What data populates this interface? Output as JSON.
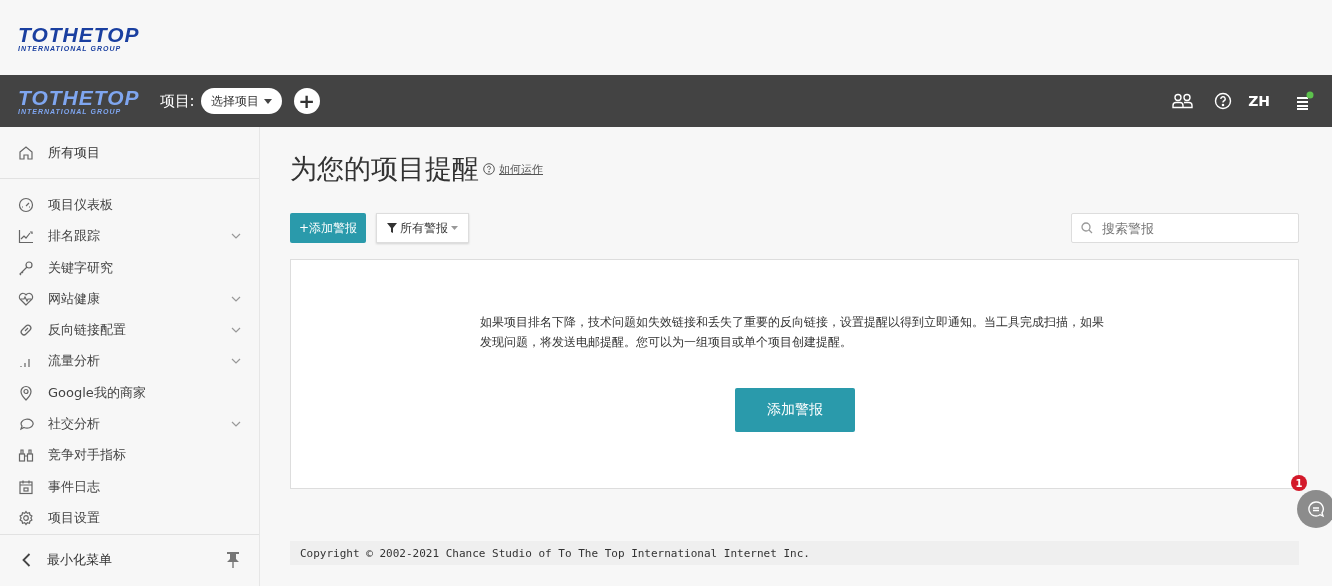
{
  "logo": {
    "name": "TOTHETOP",
    "tagline": "INTERNATIONAL GROUP"
  },
  "navbar": {
    "logo": {
      "name": "TOTHETOP",
      "tagline": "INTERNATIONAL GROUP"
    },
    "project_label": "项目:",
    "project_select": "选择项目",
    "add": "+",
    "language": "ZH",
    "menu_notification": true
  },
  "sidebar": {
    "top_item": {
      "label": "所有项目"
    },
    "items": [
      {
        "label": "项目仪表板",
        "expandable": false
      },
      {
        "label": "排名跟踪",
        "expandable": true
      },
      {
        "label": "关键字研究",
        "expandable": false
      },
      {
        "label": "网站健康",
        "expandable": true
      },
      {
        "label": "反向链接配置",
        "expandable": true
      },
      {
        "label": "流量分析",
        "expandable": true
      },
      {
        "label": "Google我的商家",
        "expandable": false
      },
      {
        "label": "社交分析",
        "expandable": true
      },
      {
        "label": "竞争对手指标",
        "expandable": false
      },
      {
        "label": "事件日志",
        "expandable": false
      },
      {
        "label": "项目设置",
        "expandable": false
      }
    ],
    "minimize": "最小化菜单"
  },
  "main": {
    "title": "为您的项目提醒",
    "help_link": "如何运作",
    "add_alert_button": "+添加警报",
    "filter_button": "所有警报",
    "search": {
      "placeholder": "搜索警报"
    },
    "empty_message": "如果项目排名下降，技术问题如失效链接和丢失了重要的反向链接，设置提醒以得到立即通知。当工具完成扫描，如果发现问题，将发送电邮提醒。您可以为一组项目或单个项目创建提醒。",
    "empty_button": "添加警报"
  },
  "footer": "Copyright © 2002-2021 Chance Studio of To The Top International Internet Inc.",
  "chat": {
    "badge": "1"
  }
}
